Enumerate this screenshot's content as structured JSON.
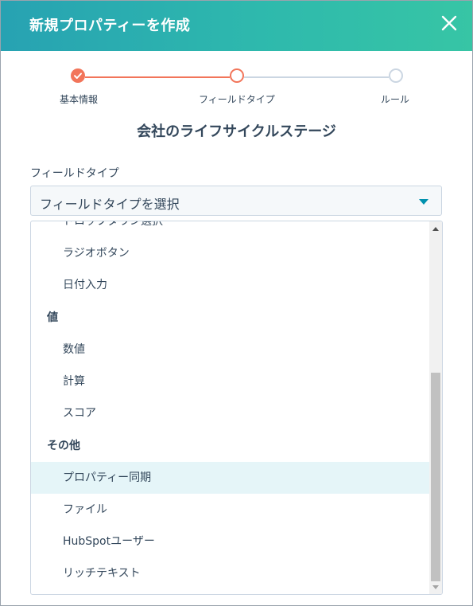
{
  "dialog": {
    "title": "新規プロパティーを作成",
    "close_icon": "close-icon"
  },
  "steps": [
    {
      "label": "基本情報",
      "state": "complete"
    },
    {
      "label": "フィールドタイプ",
      "state": "current"
    },
    {
      "label": "ルール",
      "state": "upcoming"
    }
  ],
  "heading": "会社のライフサイクルステージ",
  "field": {
    "label": "フィールドタイプ",
    "select_placeholder": "フィールドタイプを選択"
  },
  "dropdown": {
    "partial_item": "ドロップダウン選択",
    "items_group0": [
      "ラジオボタン",
      "日付入力"
    ],
    "group1": "値",
    "items_group1": [
      "数値",
      "計算",
      "スコア"
    ],
    "group2": "その他",
    "items_group2": [
      "プロパティー同期",
      "ファイル",
      "HubSpotユーザー",
      "リッチテキスト"
    ],
    "highlighted": "プロパティー同期"
  },
  "colors": {
    "header_start": "#27a2b2",
    "header_end": "#37c5a5",
    "step_accent": "#f2755a",
    "step_inactive": "#cbd6e2",
    "highlight": "#e5f5f8",
    "caret": "#0091ae",
    "text": "#33475b"
  }
}
